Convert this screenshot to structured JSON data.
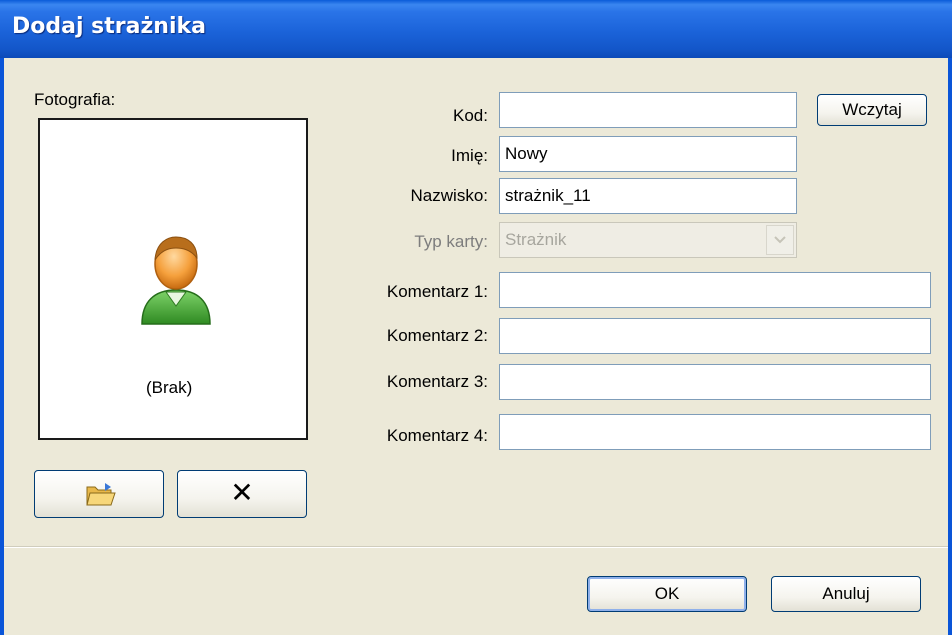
{
  "window": {
    "title": "Dodaj strażnika"
  },
  "photo": {
    "label": "Fotografia:",
    "empty_text": "(Brak)"
  },
  "form": {
    "kod": {
      "label": "Kod:",
      "value": ""
    },
    "imie": {
      "label": "Imię:",
      "value": "Nowy"
    },
    "nazwisko": {
      "label": "Nazwisko:",
      "value": "strażnik_11"
    },
    "typ_karty": {
      "label": "Typ karty:",
      "value": "Strażnik"
    },
    "komentarz1": {
      "label": "Komentarz 1:",
      "value": ""
    },
    "komentarz2": {
      "label": "Komentarz 2:",
      "value": ""
    },
    "komentarz3": {
      "label": "Komentarz 3:",
      "value": ""
    },
    "komentarz4": {
      "label": "Komentarz 4:",
      "value": ""
    }
  },
  "buttons": {
    "wczytaj": "Wczytaj",
    "ok": "OK",
    "anuluj": "Anuluj",
    "remove_glyph": "✕"
  },
  "colors": {
    "titlebar": "#1b63d9",
    "background": "#ece9d8",
    "button_border": "#003c74"
  }
}
